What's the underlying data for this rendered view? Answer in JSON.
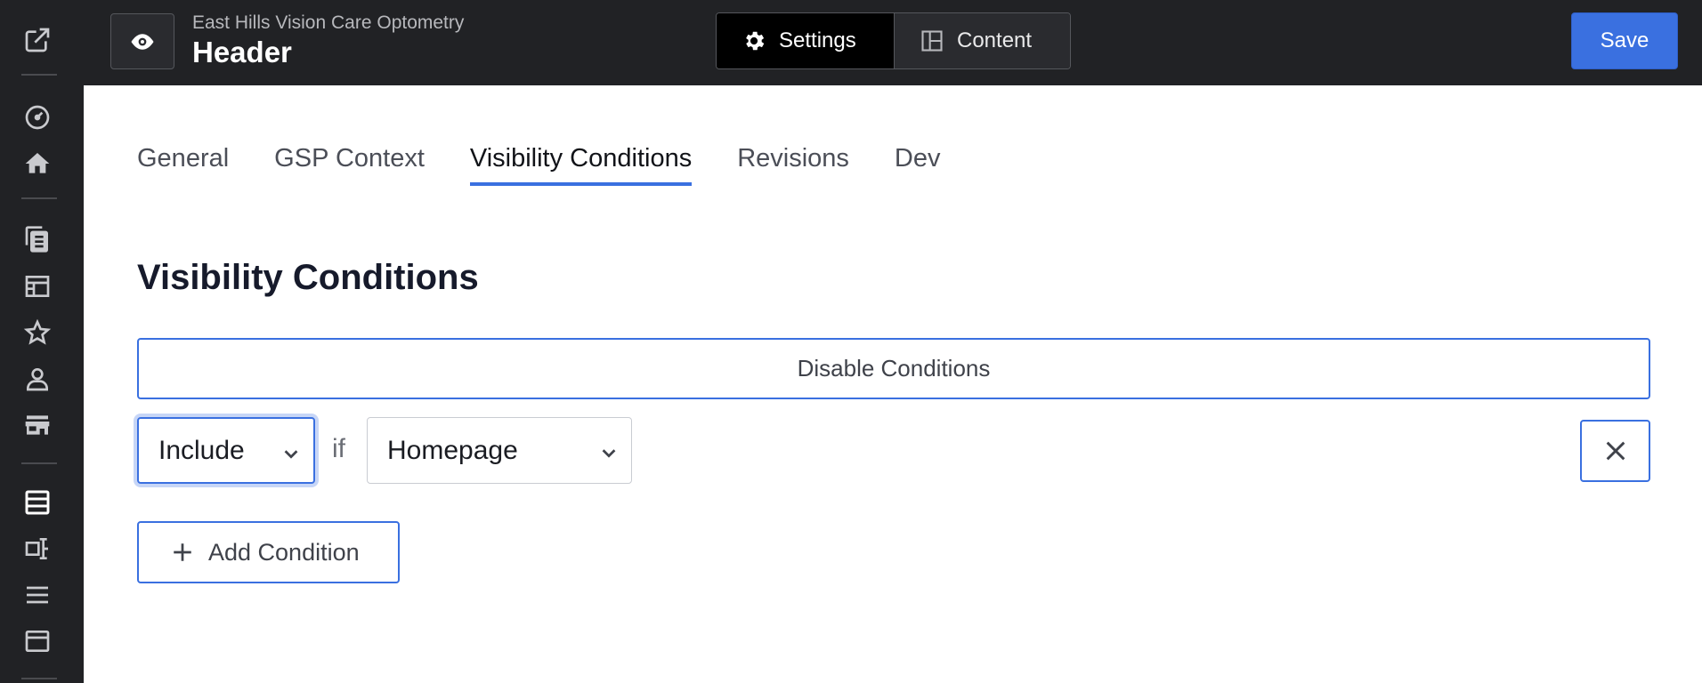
{
  "sidebar": {
    "icons": [
      "external-edit-icon",
      "dashboard-icon",
      "home-icon",
      "pages-icon",
      "layout-icon",
      "star-icon",
      "user-icon",
      "store-icon",
      "list-icon",
      "form-icon",
      "menu-icon",
      "window-icon"
    ]
  },
  "header": {
    "site_name": "East Hills Vision Care Optometry",
    "page_name": "Header",
    "settings_label": "Settings",
    "content_label": "Content",
    "save_label": "Save"
  },
  "tabs": [
    {
      "label": "General"
    },
    {
      "label": "GSP Context"
    },
    {
      "label": "Visibility Conditions"
    },
    {
      "label": "Revisions"
    },
    {
      "label": "Dev"
    }
  ],
  "main": {
    "title": "Visibility Conditions",
    "disable_label": "Disable Conditions",
    "condition": {
      "mode": "Include",
      "connector": "if",
      "target": "Homepage"
    },
    "add_label": "Add Condition"
  },
  "colors": {
    "accent": "#3a70e0",
    "chrome": "#212225"
  }
}
